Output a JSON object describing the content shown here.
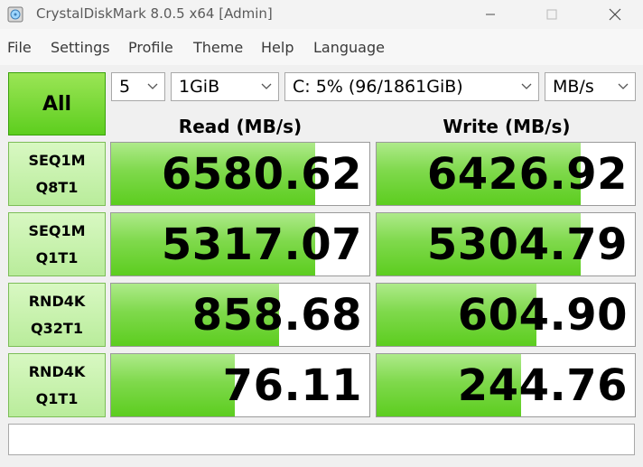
{
  "window": {
    "title": "CrystalDiskMark 8.0.5 x64 [Admin]"
  },
  "menu": [
    "File",
    "Settings",
    "Profile",
    "Theme",
    "Help",
    "Language"
  ],
  "controls": {
    "all_label": "All",
    "count": "5",
    "size": "1GiB",
    "drive": "C: 5% (96/1861GiB)",
    "unit": "MB/s"
  },
  "headers": {
    "read": "Read (MB/s)",
    "write": "Write (MB/s)"
  },
  "results": [
    {
      "line1": "SEQ1M",
      "line2": "Q8T1",
      "read": "6580.62",
      "read_fill": 0.79,
      "write": "6426.92",
      "write_fill": 0.79
    },
    {
      "line1": "SEQ1M",
      "line2": "Q1T1",
      "read": "5317.07",
      "read_fill": 0.79,
      "write": "5304.79",
      "write_fill": 0.79
    },
    {
      "line1": "RND4K",
      "line2": "Q32T1",
      "read": "858.68",
      "read_fill": 0.65,
      "write": "604.90",
      "write_fill": 0.62
    },
    {
      "line1": "RND4K",
      "line2": "Q1T1",
      "read": "76.11",
      "read_fill": 0.48,
      "write": "244.76",
      "write_fill": 0.56
    }
  ],
  "comment": "",
  "colors": {
    "accent_green": "#5dce1e",
    "label_green": "#c8f3ad"
  }
}
